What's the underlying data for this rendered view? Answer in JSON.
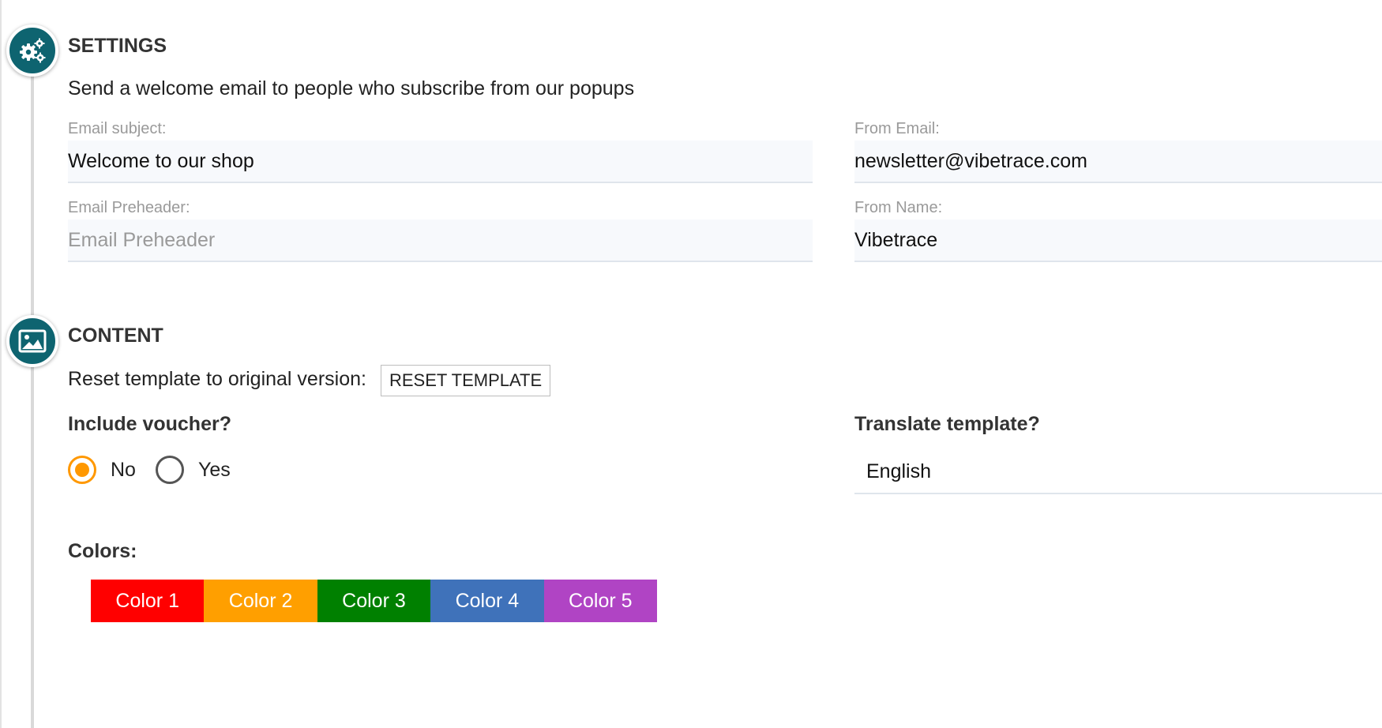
{
  "settings": {
    "title": "SETTINGS",
    "icon": "gears-icon",
    "description": "Send a welcome email to people who subscribe from our popups",
    "email_subject": {
      "label": "Email subject:",
      "value": "Welcome to our shop"
    },
    "from_email": {
      "label": "From Email:",
      "value": "newsletter@vibetrace.com"
    },
    "email_preheader": {
      "label": "Email Preheader:",
      "placeholder": "Email Preheader"
    },
    "from_name": {
      "label": "From Name:",
      "value": "Vibetrace"
    }
  },
  "content": {
    "title": "CONTENT",
    "icon": "image-icon",
    "reset_text": "Reset template to original version:",
    "reset_button": "RESET TEMPLATE",
    "voucher": {
      "label": "Include voucher?",
      "options": [
        {
          "label": "No",
          "selected": true
        },
        {
          "label": "Yes",
          "selected": false
        }
      ]
    },
    "translate": {
      "label": "Translate template?",
      "value": "English"
    },
    "colors": {
      "label": "Colors:",
      "swatches": [
        {
          "label": "Color 1",
          "color": "#ff0000"
        },
        {
          "label": "Color 2",
          "color": "#ff9f00"
        },
        {
          "label": "Color 3",
          "color": "#008000"
        },
        {
          "label": "Color 4",
          "color": "#3f72ba"
        },
        {
          "label": "Color 5",
          "color": "#b044c4"
        }
      ]
    }
  },
  "theme": {
    "accent": "#0e6470",
    "radio_selected": "#ff9800"
  }
}
